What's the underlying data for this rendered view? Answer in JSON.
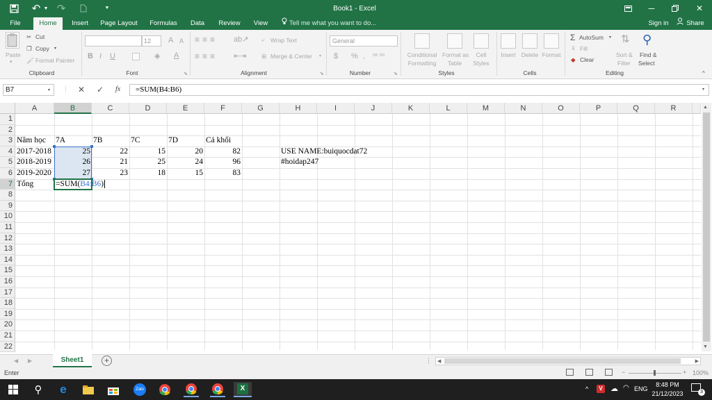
{
  "title_bar": {
    "title": "Book1 - Excel",
    "sign_in": "Sign in",
    "share": "Share",
    "minimize_glyph": "─",
    "close_glyph": "✕"
  },
  "tabs": [
    "File",
    "Home",
    "Insert",
    "Page Layout",
    "Formulas",
    "Data",
    "Review",
    "View"
  ],
  "tell_me": "Tell me what you want to do...",
  "ribbon": {
    "clipboard": {
      "label": "Clipboard",
      "paste": "Paste",
      "cut": "Cut",
      "copy": "Copy",
      "format_painter": "Format Painter"
    },
    "font": {
      "label": "Font",
      "font_size": "12",
      "bold": "B",
      "italic": "I",
      "underline": "U",
      "grow": "A",
      "shrink": "A"
    },
    "alignment": {
      "label": "Alignment",
      "wrap_text": "Wrap Text",
      "merge_center": "Merge & Center"
    },
    "number": {
      "label": "Number",
      "format": "General",
      "currency": "$",
      "percent": "%"
    },
    "styles": {
      "label": "Styles",
      "conditional": [
        "Conditional",
        "Formatting"
      ],
      "format_table": [
        "Format as",
        "Table"
      ],
      "cell_styles": [
        "Cell",
        "Styles"
      ]
    },
    "cells": {
      "label": "Cells",
      "insert": "Insert",
      "delete": "Delete",
      "format": "Format"
    },
    "editing": {
      "label": "Editing",
      "autosum": "AutoSum",
      "fill": "Fill",
      "clear": "Clear",
      "sort": [
        "Sort &",
        "Filter"
      ],
      "find": [
        "Find &",
        "Select"
      ]
    }
  },
  "formula_bar": {
    "name_box": "B7",
    "fx": "fx",
    "formula": "=SUM(B4:B6)"
  },
  "columns": [
    "A",
    "B",
    "C",
    "D",
    "E",
    "F",
    "G",
    "H",
    "I",
    "J",
    "K",
    "L",
    "M",
    "N",
    "O",
    "P",
    "Q",
    "R"
  ],
  "rows": [
    "1",
    "2",
    "3",
    "4",
    "5",
    "6",
    "7",
    "8",
    "9",
    "10",
    "11",
    "12",
    "13",
    "14",
    "15",
    "16",
    "17",
    "18",
    "19",
    "20",
    "21",
    "22"
  ],
  "cells": {
    "A3": "Năm học",
    "B3": "7A",
    "C3": "7B",
    "D3": "7C",
    "E3": "7D",
    "F3": "Cả khối",
    "A4": "2017-2018",
    "B4": "25",
    "C4": "22",
    "D4": "15",
    "E4": "20",
    "F4": "82",
    "H4": "USE NAME:buiquocdat72",
    "A5": "2018-2019",
    "B5": "26",
    "C5": "21",
    "D5": "25",
    "E5": "24",
    "F5": "96",
    "H5": "#hoidap247",
    "A6": "2019-2020",
    "B6": "27",
    "C6": "23",
    "D6": "18",
    "E6": "15",
    "F6": "83",
    "A7": "Tổng",
    "B7_prefix": "=SUM(",
    "B7_ref": "B4:B6",
    "B7_suffix": ")"
  },
  "sheet_tab": "Sheet1",
  "status": {
    "mode": "Enter",
    "zoom": "100%"
  },
  "taskbar": {
    "time": "8:48 PM",
    "date": "21/12/2023",
    "lang": "ENG",
    "notif_count": "3",
    "zalo": "Zalo"
  },
  "colors": {
    "excel_green": "#217346",
    "selection_fill": "#dce6f2",
    "selection_border": "#3a73c8",
    "ref_blue": "#3a73c8"
  }
}
